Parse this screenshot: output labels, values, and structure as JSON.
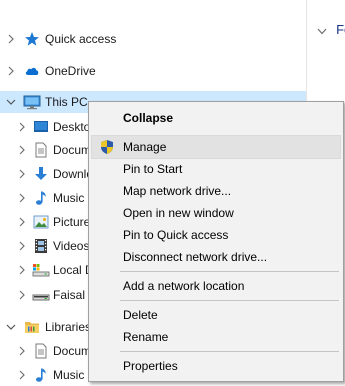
{
  "right_pane": {
    "header_label": "Fo"
  },
  "tree": [
    {
      "label": "Quick access",
      "icon": "star-icon",
      "expanded": false
    },
    {
      "label": "OneDrive",
      "icon": "cloud-icon",
      "expanded": false
    },
    {
      "label": "This PC",
      "icon": "computer-icon",
      "expanded": true,
      "selected": true
    },
    {
      "label": "Desktop",
      "icon": "desktop-folder-icon",
      "expanded": false
    },
    {
      "label": "Documents",
      "icon": "document-icon",
      "expanded": false
    },
    {
      "label": "Downloads",
      "icon": "download-icon",
      "expanded": false
    },
    {
      "label": "Music",
      "icon": "music-note-icon",
      "expanded": false
    },
    {
      "label": "Pictures",
      "icon": "pictures-icon",
      "expanded": false
    },
    {
      "label": "Videos",
      "icon": "film-icon",
      "expanded": false
    },
    {
      "label": "Local Disk (C:)",
      "icon": "local-disk-icon",
      "expanded": false
    },
    {
      "label": "Faisal (D:)",
      "icon": "drive-icon",
      "expanded": false
    },
    {
      "label": "Libraries",
      "icon": "libraries-folder-icon",
      "expanded": true
    },
    {
      "label": "Documents",
      "icon": "document-icon",
      "expanded": false
    },
    {
      "label": "Music",
      "icon": "music-note-icon",
      "expanded": false
    }
  ],
  "context_menu": {
    "items": [
      {
        "label": "Collapse",
        "bold": true
      },
      {
        "label": "Manage",
        "icon": "uac-shield-icon",
        "highlighted": true
      },
      {
        "label": "Pin to Start"
      },
      {
        "label": "Map network drive..."
      },
      {
        "label": "Open in new window"
      },
      {
        "label": "Pin to Quick access"
      },
      {
        "label": "Disconnect network drive..."
      },
      {
        "label": "Add a network location"
      },
      {
        "label": "Delete"
      },
      {
        "label": "Rename"
      },
      {
        "label": "Properties"
      }
    ]
  }
}
